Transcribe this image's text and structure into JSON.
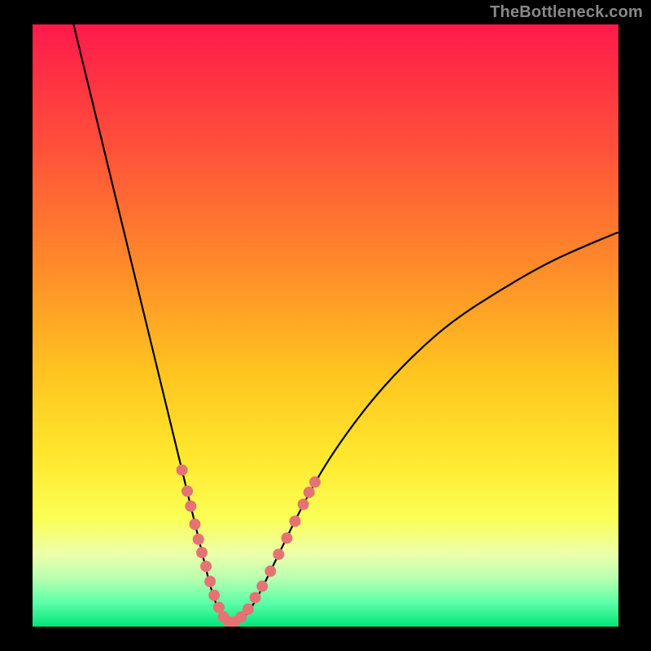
{
  "watermark": "TheBottleneck.com",
  "chart_data": {
    "type": "line",
    "title": "",
    "xlabel": "",
    "ylabel": "",
    "xlim": [
      0,
      100
    ],
    "ylim": [
      0,
      100
    ],
    "grid": false,
    "legend": false,
    "background_gradient_stops": [
      {
        "offset": 0.0,
        "color": "#ff1a4b"
      },
      {
        "offset": 0.2,
        "color": "#ff4f3a"
      },
      {
        "offset": 0.4,
        "color": "#ff8a2a"
      },
      {
        "offset": 0.58,
        "color": "#ffc51f"
      },
      {
        "offset": 0.72,
        "color": "#ffe82e"
      },
      {
        "offset": 0.82,
        "color": "#fbff55"
      },
      {
        "offset": 0.88,
        "color": "#ecffaa"
      },
      {
        "offset": 0.92,
        "color": "#b8ffb0"
      },
      {
        "offset": 0.96,
        "color": "#5dffa8"
      },
      {
        "offset": 1.0,
        "color": "#00e57a"
      }
    ],
    "curve": {
      "description": "V-shaped bottleneck curve; minimum near x≈33, rises steeply left, rises moderately right",
      "points": [
        {
          "x": 7.0,
          "y": 100.0
        },
        {
          "x": 9.0,
          "y": 92.0
        },
        {
          "x": 11.0,
          "y": 84.0
        },
        {
          "x": 13.0,
          "y": 76.0
        },
        {
          "x": 15.0,
          "y": 68.0
        },
        {
          "x": 17.0,
          "y": 60.0
        },
        {
          "x": 19.0,
          "y": 52.0
        },
        {
          "x": 21.0,
          "y": 44.0
        },
        {
          "x": 23.0,
          "y": 36.0
        },
        {
          "x": 25.0,
          "y": 28.0
        },
        {
          "x": 27.0,
          "y": 20.0
        },
        {
          "x": 29.0,
          "y": 12.0
        },
        {
          "x": 30.5,
          "y": 6.0
        },
        {
          "x": 32.0,
          "y": 2.0
        },
        {
          "x": 33.5,
          "y": 0.5
        },
        {
          "x": 35.0,
          "y": 0.5
        },
        {
          "x": 37.0,
          "y": 2.5
        },
        {
          "x": 39.0,
          "y": 6.0
        },
        {
          "x": 42.0,
          "y": 12.0
        },
        {
          "x": 46.0,
          "y": 20.0
        },
        {
          "x": 50.0,
          "y": 27.0
        },
        {
          "x": 55.0,
          "y": 34.0
        },
        {
          "x": 60.0,
          "y": 40.0
        },
        {
          "x": 66.0,
          "y": 46.0
        },
        {
          "x": 72.0,
          "y": 51.0
        },
        {
          "x": 80.0,
          "y": 56.0
        },
        {
          "x": 88.0,
          "y": 60.5
        },
        {
          "x": 95.0,
          "y": 63.5
        },
        {
          "x": 100.0,
          "y": 65.5
        }
      ]
    },
    "dot_clusters": {
      "description": "salmon-pink dots clustered along the lower V of the curve",
      "color": "#e57373",
      "radius": 7,
      "points": [
        {
          "x": 25.5,
          "y": 26.0
        },
        {
          "x": 26.4,
          "y": 22.5
        },
        {
          "x": 27.0,
          "y": 20.0
        },
        {
          "x": 27.7,
          "y": 17.0
        },
        {
          "x": 28.3,
          "y": 14.5
        },
        {
          "x": 28.9,
          "y": 12.3
        },
        {
          "x": 29.6,
          "y": 10.0
        },
        {
          "x": 30.3,
          "y": 7.5
        },
        {
          "x": 31.0,
          "y": 5.2
        },
        {
          "x": 31.8,
          "y": 3.2
        },
        {
          "x": 32.6,
          "y": 1.6
        },
        {
          "x": 33.5,
          "y": 0.8
        },
        {
          "x": 34.5,
          "y": 0.8
        },
        {
          "x": 35.6,
          "y": 1.6
        },
        {
          "x": 36.8,
          "y": 2.9
        },
        {
          "x": 38.0,
          "y": 4.8
        },
        {
          "x": 39.2,
          "y": 6.7
        },
        {
          "x": 40.6,
          "y": 9.2
        },
        {
          "x": 42.0,
          "y": 12.0
        },
        {
          "x": 43.4,
          "y": 14.7
        },
        {
          "x": 44.8,
          "y": 17.5
        },
        {
          "x": 46.2,
          "y": 20.3
        },
        {
          "x": 47.2,
          "y": 22.3
        },
        {
          "x": 48.2,
          "y": 24.0
        }
      ]
    }
  }
}
